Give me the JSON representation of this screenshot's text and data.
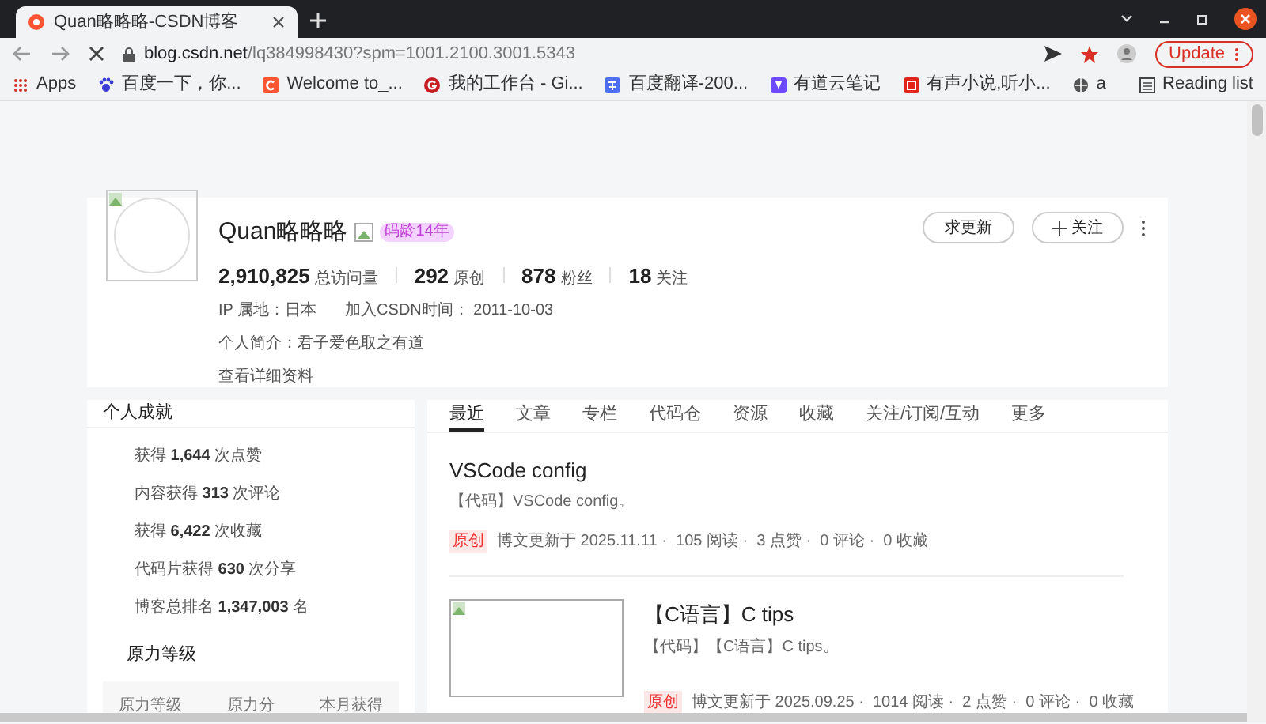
{
  "browser": {
    "tab_title": "Quan略略略-CSDN博客",
    "url_host": "blog.csdn.net",
    "url_path": "/lq384998430?spm=1001.2100.3001.5343",
    "update_label": "Update",
    "bookmarks": [
      {
        "label": "Apps",
        "kind": "apps"
      },
      {
        "label": "百度一下，你...",
        "kind": "paw"
      },
      {
        "label": "Welcome to_...",
        "kind": "c"
      },
      {
        "label": "我的工作台 - Gi...",
        "kind": "g"
      },
      {
        "label": "百度翻译-200...",
        "kind": "trans"
      },
      {
        "label": "有道云笔记",
        "kind": "note"
      },
      {
        "label": "有声小说,听小...",
        "kind": "book"
      },
      {
        "label": "a",
        "kind": "globe"
      }
    ],
    "reading_list": "Reading list"
  },
  "profile": {
    "name": "Quan略略略",
    "badge": "码龄14年",
    "stats": [
      {
        "value": "2,910,825",
        "label": "总访问量"
      },
      {
        "value": "292",
        "label": "原创"
      },
      {
        "value": "878",
        "label": "粉丝"
      },
      {
        "value": "18",
        "label": "关注"
      }
    ],
    "ip": "IP 属地：日本",
    "joined": "加入CSDN时间： 2011-10-03",
    "bio": "个人简介：君子爱色取之有道",
    "details_link": "查看详细资料",
    "buttons": [
      "求更新",
      "关注"
    ]
  },
  "achievements": {
    "title": "个人成就",
    "items": [
      "获得 **1,644** 次点赞",
      "内容获得 **313** 次评论",
      "获得 **6,422** 次收藏",
      "代码片获得 **630** 次分享",
      "博客总排名 **1,347,003** 名"
    ],
    "level_title": "原力等级",
    "level_columns": [
      "原力等级",
      "原力分",
      "本月获得"
    ]
  },
  "tabs": [
    {
      "label": "最近",
      "selected": true
    },
    {
      "label": "文章",
      "selected": false
    },
    {
      "label": "专栏",
      "selected": false
    },
    {
      "label": "代码仓",
      "selected": false
    },
    {
      "label": "资源",
      "selected": false
    },
    {
      "label": "收藏",
      "selected": false
    },
    {
      "label": "关注/订阅/互动",
      "selected": false
    },
    {
      "label": "更多",
      "selected": false
    }
  ],
  "articles": [
    {
      "title": "VSCode config",
      "summary": "【代码】VSCode config。",
      "tag": "原创",
      "meta": "博文更新于 2025.11.11 ·  105 阅读 ·  3 点赞 ·  0 评论 ·  0 收藏",
      "has_thumbnail": false
    },
    {
      "title": "【C语言】C tips",
      "summary": "【代码】【C语言】C tips。",
      "tag": "原创",
      "meta": "博文更新于 2025.09.25 ·  1014 阅读 ·  2 点赞 ·  0 评论 ·  0 收藏",
      "has_thumbnail": true
    }
  ]
}
